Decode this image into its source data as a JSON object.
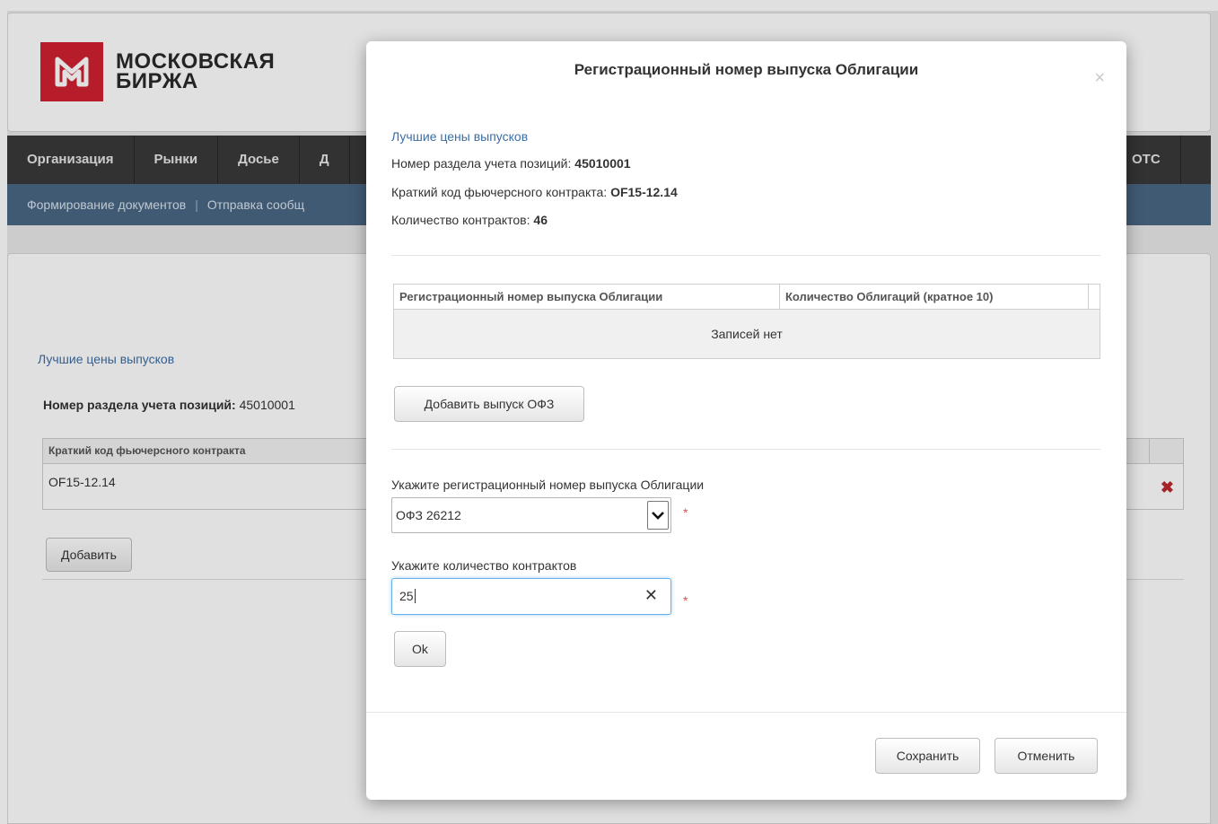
{
  "logo": {
    "line1": "МОСКОВСКАЯ",
    "line2": "БИРЖА",
    "brand_color": "#d12030"
  },
  "nav": {
    "items": [
      "Организация",
      "Рынки",
      "Досье",
      "Д"
    ],
    "otc": "OTC"
  },
  "subnav": {
    "items": [
      "Формирование документов",
      "Отправка сообщ"
    ]
  },
  "background": {
    "link": "Лучшие цены выпусков",
    "section_label": "Номер раздела учета позиций:",
    "section_value": "45010001",
    "table_header": "Краткий код фьючерсного контракта",
    "table_value": "OF15-12.14",
    "add_button": "Добавить"
  },
  "modal": {
    "title": "Регистрационный номер выпуска Облигации",
    "close": "×",
    "link": "Лучшие цены выпусков",
    "section_label": "Номер раздела учета позиций:",
    "section_value": "45010001",
    "contract_label": "Краткий код фьючерсного контракта:",
    "contract_value": "OF15-12.14",
    "count_label": "Количество контрактов:",
    "count_value": "46",
    "table": {
      "headers": [
        "Регистрационный номер выпуска Облигации",
        "Количество Облигаций (кратное 10)"
      ],
      "empty_text": "Записей нет"
    },
    "add_ofz_button": "Добавить выпуск ОФЗ",
    "select_label": "Укажите регистрационный номер выпуска Облигации",
    "select_value": "ОФЗ 26212",
    "qty_label": "Укажите количество контрактов",
    "qty_value": "25",
    "required_mark": "*",
    "ok_button": "Ok",
    "save_button": "Сохранить",
    "cancel_button": "Отменить"
  }
}
